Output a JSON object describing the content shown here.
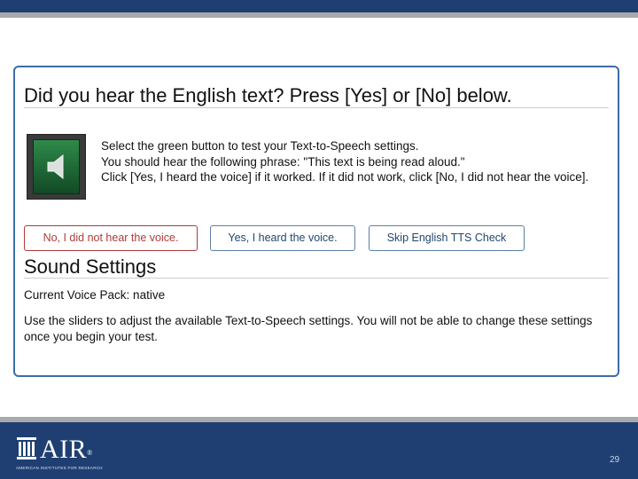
{
  "dialog": {
    "title": "Did you hear the English text? Press [Yes] or [No] below.",
    "instructions": [
      "Select the green button to test your Text-to-Speech settings.",
      "You should hear the following phrase: \"This text is being read aloud.\"",
      "Click [Yes, I heard the voice] if it worked. If it did not work, click [No, I did not hear the voice]."
    ],
    "buttons": {
      "no_label": "No, I did not hear the voice.",
      "yes_label": "Yes, I heard the voice.",
      "skip_label": "Skip English TTS Check"
    }
  },
  "sound_settings": {
    "title": "Sound Settings",
    "voice_pack": "Current Voice Pack: native",
    "slider_instructions": "Use the sliders to adjust the available Text-to-Speech settings. You will not be able to change these settings once you begin your test."
  },
  "footer": {
    "logo_text": "AIR",
    "logo_registered": "®",
    "logo_tagline": "AMERICAN INSTITUTES FOR RESEARCH",
    "page_number": "29"
  },
  "colors": {
    "header_blue": "#1f3f73",
    "accent_gray": "#a7a9ac",
    "speaker_green": "#2f8a4a",
    "no_button_red": "#b03a3a",
    "panel_border": "#3d6ca8"
  },
  "icons": {
    "play": "speaker-icon",
    "logo": "building-icon"
  }
}
